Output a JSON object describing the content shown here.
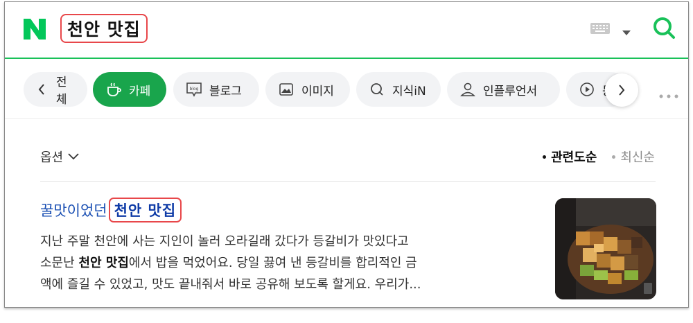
{
  "header": {
    "logo_letter": "N",
    "query": "천안 맛집",
    "icons": {
      "keyboard": "keyboard-icon",
      "dropdown": "chevron-down-icon",
      "search": "search-icon"
    }
  },
  "tabs": [
    {
      "label": "전체",
      "icon": "chevron-left-icon"
    },
    {
      "label": "카페",
      "icon": "cafe-cup-icon",
      "active": true
    },
    {
      "label": "블로그",
      "icon": "blog-icon"
    },
    {
      "label": "이미지",
      "icon": "image-icon"
    },
    {
      "label": "지식iN",
      "icon": "kin-icon"
    },
    {
      "label": "인플루언서",
      "icon": "person-icon"
    },
    {
      "label": "동",
      "icon": "play-icon"
    }
  ],
  "filters": {
    "options_label": "옵션",
    "sort": [
      {
        "label": "관련도순",
        "active": true
      },
      {
        "label": "최신순",
        "active": false
      }
    ]
  },
  "result": {
    "title_prefix": "꿀맛이었던",
    "title_highlight": "천안 맛집",
    "snippet_line1": "지난 주말 천안에 사는 지인이 놀러 오라길래 갔다가 등갈비가 맛있다고",
    "snippet_line2_a": "소문난 ",
    "snippet_line2_bold": "천안 맛집",
    "snippet_line2_b": "에서 밥을 먹었어요. 당일 끓여 낸 등갈비를 합리적인 금",
    "snippet_line3": "액에 즐길 수 있었고, 맛도 끝내줘서 바로 공유해 보도록 할게요. 우리가..."
  },
  "colors": {
    "brand_green": "#19c159",
    "active_tab": "#19a54c",
    "title_link": "#1a4fb3",
    "highlight_border": "#e8474a"
  }
}
